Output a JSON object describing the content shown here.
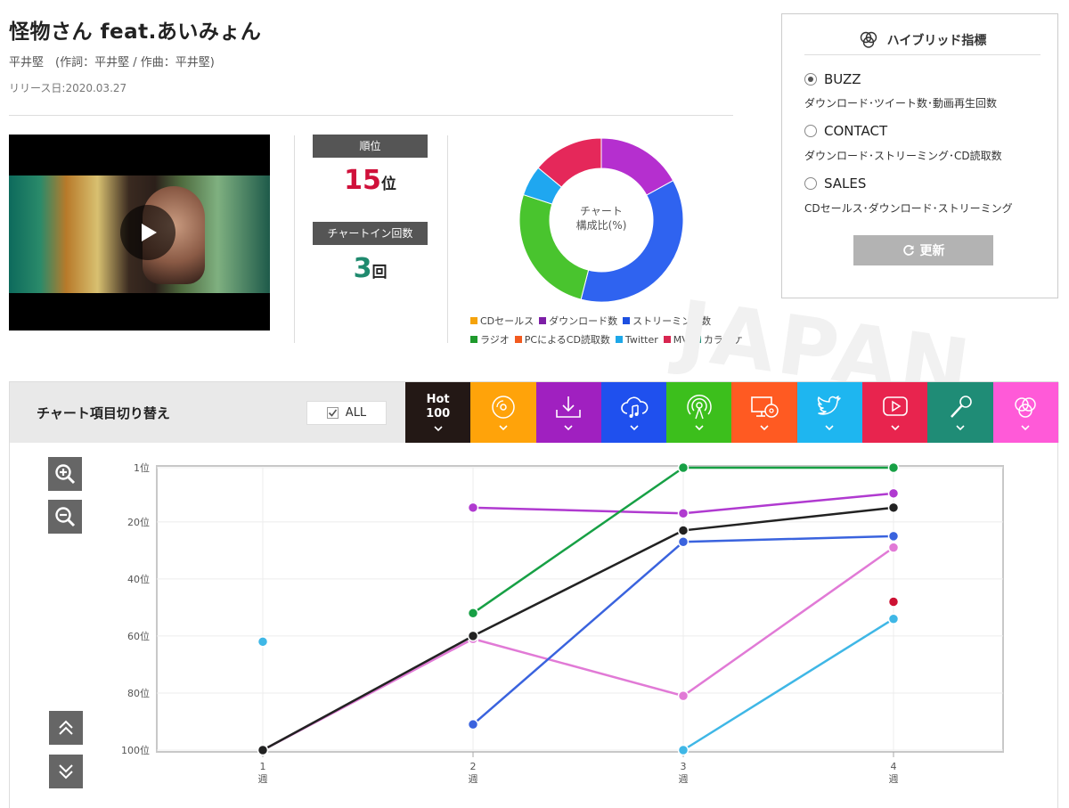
{
  "song": {
    "title": "怪物さん feat.あいみょん",
    "credits": "平井堅　(作詞：平井堅 / 作曲：平井堅)",
    "release": "リリース日:2020.03.27"
  },
  "video": {
    "play_label": "play"
  },
  "stats": {
    "rank_label": "順位",
    "rank_value": "15",
    "rank_unit": "位",
    "count_label": "チャートイン回数",
    "count_value": "3",
    "count_unit": "回"
  },
  "composition": {
    "center_line1": "チャート",
    "center_line2": "構成比(%)",
    "slices": [
      {
        "name": "ダウンロード数",
        "value": 17,
        "color": "#b52fcf"
      },
      {
        "name": "ストリーミング数",
        "value": 37,
        "color": "#2f63f0"
      },
      {
        "name": "ラジオ",
        "value": 26,
        "color": "#49c42e"
      },
      {
        "name": "Twitter",
        "value": 6,
        "color": "#1fa7f0"
      },
      {
        "name": "MV",
        "value": 14,
        "color": "#e5285a"
      }
    ],
    "legend_row1": [
      {
        "label": "CDセールス",
        "color": "#f5a30c"
      },
      {
        "label": "ダウンロード数",
        "color": "#7d1ea6"
      },
      {
        "label": "ストリーミング数",
        "color": "#1d4fe0"
      }
    ],
    "legend_row2": [
      {
        "label": "ラジオ",
        "color": "#1f9a2c"
      },
      {
        "label": "PCによるCD読取数",
        "color": "#f25a1f"
      },
      {
        "label": "Twitter",
        "color": "#1ea7e8"
      },
      {
        "label": "MV",
        "color": "#d82650"
      },
      {
        "label": "カラオケ",
        "color": "#23907a"
      }
    ]
  },
  "hybrid": {
    "title": "ハイブリッド指標",
    "options": [
      {
        "label": "BUZZ",
        "desc": "ダウンロード･ツイート数･動画再生回数",
        "selected": true
      },
      {
        "label": "CONTACT",
        "desc": "ダウンロード･ストリーミング･CD読取数",
        "selected": false
      },
      {
        "label": "SALES",
        "desc": "CDセールス･ダウンロード･ストリーミング",
        "selected": false
      }
    ],
    "update_label": "更新"
  },
  "watermark": "JAPAN",
  "chart_controls": {
    "title": "チャート項目切り替え",
    "all_label": "ALL",
    "hot_line1": "Hot",
    "hot_line2": "100",
    "tabs": [
      {
        "icon": "cd-icon",
        "color": "#ffa30a"
      },
      {
        "icon": "download-icon",
        "color": "#a020c0"
      },
      {
        "icon": "streaming-cloud-icon",
        "color": "#1f50ee"
      },
      {
        "icon": "radio-icon",
        "color": "#3cbf1c"
      },
      {
        "icon": "pc-cd-read-icon",
        "color": "#ff5a22"
      },
      {
        "icon": "twitter-icon",
        "color": "#1eb6f0"
      },
      {
        "icon": "mv-play-icon",
        "color": "#e8244e"
      },
      {
        "icon": "karaoke-mic-icon",
        "color": "#1f8c76"
      },
      {
        "icon": "hybrid-icon",
        "color": "#ff5ad8"
      }
    ]
  },
  "chart_data": {
    "type": "line",
    "x": [
      1,
      2,
      3,
      4
    ],
    "x_tick_labels": [
      [
        "1",
        "週"
      ],
      [
        "2",
        "週"
      ],
      [
        "3",
        "週"
      ],
      [
        "4",
        "週"
      ]
    ],
    "y_tick_labels": [
      "1位",
      "20位",
      "40位",
      "60位",
      "80位",
      "100位"
    ],
    "y_ticks": [
      1,
      20,
      40,
      60,
      80,
      100
    ],
    "ylim": [
      1,
      100
    ],
    "y_reversed": true,
    "grid": true,
    "series": [
      {
        "color": "#3fb7e6",
        "values": [
          62,
          null,
          100,
          54
        ]
      },
      {
        "color": "#e17ad6",
        "values": [
          100,
          61,
          81,
          29
        ]
      },
      {
        "color": "#3a63de",
        "values": [
          null,
          91,
          27,
          25
        ]
      },
      {
        "color": "#b03ad0",
        "values": [
          null,
          15,
          17,
          10
        ]
      },
      {
        "color": "#17a045",
        "values": [
          null,
          52,
          1,
          1
        ]
      },
      {
        "color": "#cc1133",
        "values": [
          null,
          null,
          null,
          48
        ]
      },
      {
        "color": "#222222",
        "values": [
          100,
          60,
          23,
          15
        ]
      }
    ]
  }
}
